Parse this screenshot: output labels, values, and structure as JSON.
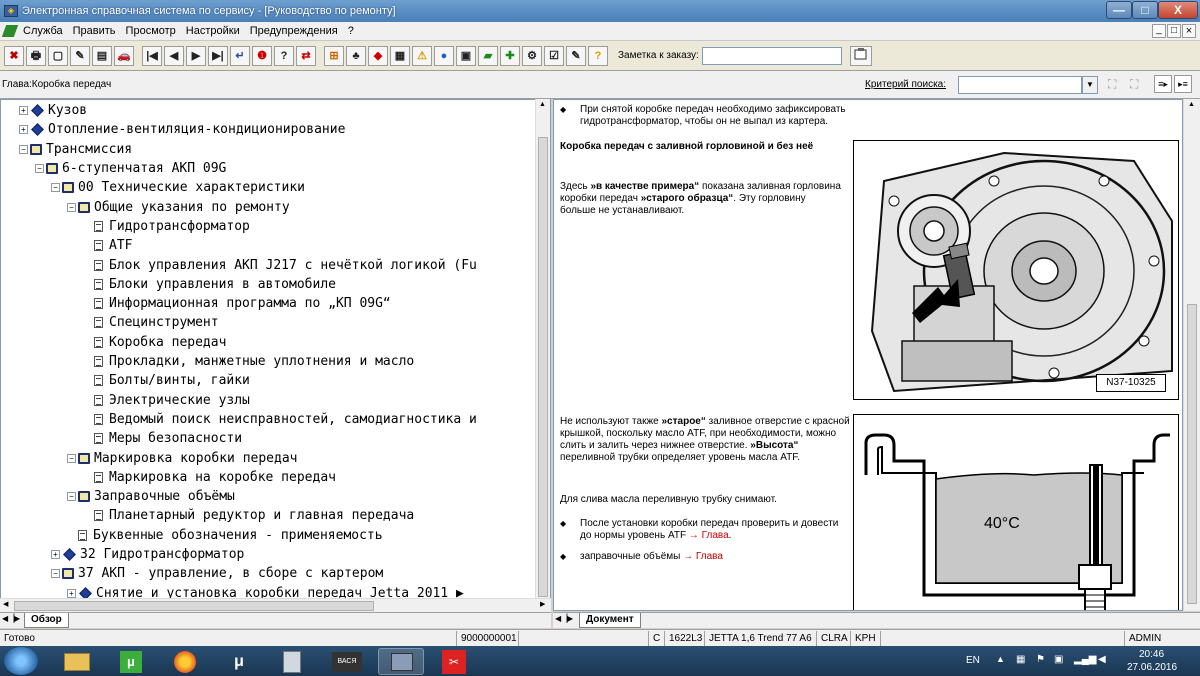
{
  "window": {
    "title": "Электронная справочная система по сервису - [Руководство по ремонту]",
    "min_label": "—",
    "max_label": "□",
    "close_label": "X"
  },
  "menu": {
    "items": [
      "Служба",
      "Править",
      "Просмотр",
      "Настройки",
      "Предупреждения",
      "?"
    ],
    "mdi_buttons": [
      "_",
      "□",
      "×"
    ]
  },
  "toolbar": {
    "buttons": [
      "✖",
      "🖶",
      "▢",
      "✎",
      "▤",
      "🚗",
      "|◀",
      "◀",
      "▶",
      "▶|",
      "↵",
      "❶",
      "?",
      "⇄",
      "⊞",
      "♣",
      "◆",
      "▦",
      "⚠",
      "●",
      "▣",
      "▰",
      "✚",
      "⚙",
      "☑",
      "✎",
      "?"
    ],
    "order_label": "Заметка к заказу:",
    "order_value": ""
  },
  "crumb": {
    "chapter": "Глава:Коробка передач",
    "search_label": "Критерий поиска:",
    "search_value": ""
  },
  "tree": {
    "rows": [
      {
        "indent": 0,
        "exp": "+",
        "icon": "diamond",
        "label": "Кузов"
      },
      {
        "indent": 0,
        "exp": "+",
        "icon": "diamond",
        "label": "Отопление-вентиляция-кондиционирование"
      },
      {
        "indent": 0,
        "exp": "−",
        "icon": "book",
        "label": "Трансмиссия"
      },
      {
        "indent": 1,
        "exp": "−",
        "icon": "book",
        "label": "6-ступенчатая АКП 09G"
      },
      {
        "indent": 2,
        "exp": "−",
        "icon": "book",
        "label": "00 Технические характеристики"
      },
      {
        "indent": 3,
        "exp": "−",
        "icon": "book",
        "label": "Общие указания по ремонту"
      },
      {
        "indent": 4,
        "exp": "",
        "icon": "doc",
        "label": "Гидротрансформатор"
      },
      {
        "indent": 4,
        "exp": "",
        "icon": "doc",
        "label": "ATF"
      },
      {
        "indent": 4,
        "exp": "",
        "icon": "doc",
        "label": "Блок управления АКП J217 с нечёткой логикой (Fu"
      },
      {
        "indent": 4,
        "exp": "",
        "icon": "doc",
        "label": "Блоки управления в автомобиле"
      },
      {
        "indent": 4,
        "exp": "",
        "icon": "doc",
        "label": "Информационная программа по „КП 09G“"
      },
      {
        "indent": 4,
        "exp": "",
        "icon": "doc",
        "label": "Специнструмент"
      },
      {
        "indent": 4,
        "exp": "",
        "icon": "doc",
        "label": "Коробка передач"
      },
      {
        "indent": 4,
        "exp": "",
        "icon": "doc",
        "label": "Прокладки, манжетные уплотнения и масло"
      },
      {
        "indent": 4,
        "exp": "",
        "icon": "doc",
        "label": "Болты/винты, гайки"
      },
      {
        "indent": 4,
        "exp": "",
        "icon": "doc",
        "label": "Электрические узлы"
      },
      {
        "indent": 4,
        "exp": "",
        "icon": "doc",
        "label": "Ведомый поиск неисправностей, самодиагностика и"
      },
      {
        "indent": 4,
        "exp": "",
        "icon": "doc",
        "label": "Меры безопасности"
      },
      {
        "indent": 3,
        "exp": "−",
        "icon": "book",
        "label": "Маркировка коробки передач"
      },
      {
        "indent": 4,
        "exp": "",
        "icon": "doc",
        "label": "Маркировка на коробке передач"
      },
      {
        "indent": 3,
        "exp": "−",
        "icon": "book",
        "label": "Заправочные объёмы"
      },
      {
        "indent": 4,
        "exp": "",
        "icon": "doc",
        "label": "Планетарный редуктор и главная передача"
      },
      {
        "indent": 3,
        "exp": "",
        "icon": "doc",
        "label": "Буквенные обозначения - применяемость"
      },
      {
        "indent": 2,
        "exp": "+",
        "icon": "diamond",
        "label": "32 Гидротрансформатор"
      },
      {
        "indent": 2,
        "exp": "−",
        "icon": "book",
        "label": "37 АКП - управление, в сборе с картером"
      },
      {
        "indent": 3,
        "exp": "+",
        "icon": "diamond",
        "label": "Снятие и установка коробки передач Jetta 2011 ▶"
      }
    ]
  },
  "left_tab": "Обзор",
  "right_tab": "Документ",
  "document": {
    "bullet1": "При снятой коробке передач необходимо зафиксировать гидротрансформатор, чтобы он не выпал из картера.",
    "heading": "Коробка передач с заливной горловиной и без неё",
    "para1_a": "Здесь ",
    "para1_b": "»в качестве примера“",
    "para1_c": " показана заливная горловина коробки передач ",
    "para1_d": "»старого образца“",
    "para1_e": ". Эту горловину больше не устанавливают.",
    "figure_code": "N37-10325",
    "para2_a": "Не используют также ",
    "para2_b": "»старое“",
    "para2_c": " заливное отверстие с красной крышкой, поскольку масло ATF, при необходимости, можно слить и залить через нижнее отверстие. ",
    "para2_d": "»Высота“",
    "para2_e": " переливной трубки определяет уровень масла ATF.",
    "para3": "Для слива масла переливную трубку снимают.",
    "bullet2_a": "После установки коробки передач проверить и довести до нормы уровень ATF ",
    "bullet2_link": "→ Глава",
    "bullet2_b": ".",
    "bullet3_a": "заправочные объёмы ",
    "bullet3_link": "→ Глава",
    "temp_label": "40°C"
  },
  "status": {
    "ready": "Готово",
    "code": "9000000001",
    "c": "C",
    "id": "1622L3",
    "model": "JETTA 1,6 Trend 77 A6",
    "engine": "CLRA",
    "gearbox": "KPH",
    "user": "ADMIN"
  },
  "taskbar": {
    "lang": "EN",
    "time": "20:46",
    "date": "27.06.2016",
    "vasya_label": "ВАСЯ"
  },
  "colors": {
    "link_red": "#cc0000",
    "tree_book": "#1a2f6c",
    "tree_diamond": "#1e3e9a"
  }
}
